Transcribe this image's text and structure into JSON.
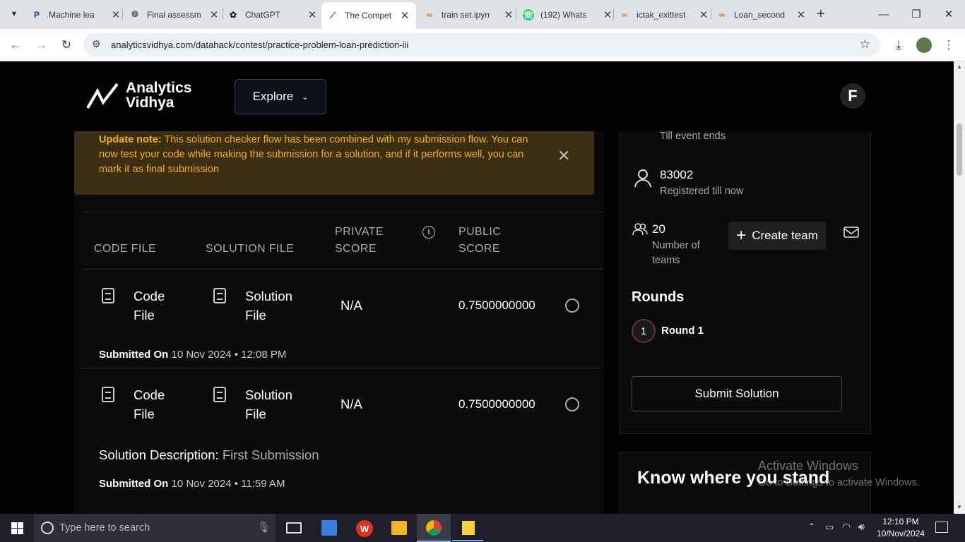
{
  "browser": {
    "tabs": [
      {
        "title": "Machine lea",
        "icon": "p-icon",
        "active": false
      },
      {
        "title": "Final assessm",
        "icon": "globe-icon",
        "active": false
      },
      {
        "title": "ChatGPT",
        "icon": "chatgpt-icon",
        "active": false
      },
      {
        "title": "The Compet",
        "icon": "av-icon",
        "active": true
      },
      {
        "title": "train set.ipyn",
        "icon": "colab-icon",
        "active": false
      },
      {
        "title": "(192) Whats",
        "icon": "whatsapp-icon",
        "active": false
      },
      {
        "title": "ictak_exittest",
        "icon": "colab-icon",
        "active": false
      },
      {
        "title": "Loan_second",
        "icon": "colab-icon",
        "active": false
      }
    ],
    "url": "analyticsvidhya.com/datahack/contest/practice-problem-loan-prediction-iii"
  },
  "header": {
    "logo_line1": "Analytics",
    "logo_line2": "Vidhya",
    "explore_label": "Explore",
    "avatar_letter": "F"
  },
  "note": {
    "label": "Update note:",
    "text": " This solution checker flow has been combined with my submission flow. You can now test your code while making the submission for a solution, and if it performs well, you can mark it as final submission"
  },
  "table": {
    "headers": {
      "code_file": "CODE FILE",
      "solution_file": "SOLUTION FILE",
      "private_score_1": "PRIVATE",
      "private_score_2": "SCORE",
      "public_score_1": "PUBLIC",
      "public_score_2": "SCORE"
    },
    "rows": [
      {
        "code_1": "Code",
        "code_2": "File",
        "sol_1": "Solution",
        "sol_2": "File",
        "private": "N/A",
        "public": "0.7500000000",
        "submitted_label": "Submitted On",
        "date": "10 Nov 2024",
        "time": "12:08 PM"
      },
      {
        "code_1": "Code",
        "code_2": "File",
        "sol_1": "Solution",
        "sol_2": "File",
        "private": "N/A",
        "public": "0.7500000000",
        "desc_label": "Solution Description:",
        "desc": "First Submission",
        "submitted_label": "Submitted On",
        "date": "10 Nov 2024",
        "time": "11:59 AM"
      }
    ]
  },
  "side": {
    "till_event": "Till event ends",
    "registered_count": "83002",
    "registered_label": "Registered till now",
    "teams_count": "20",
    "teams_label_1": "Number of",
    "teams_label_2": "teams",
    "create_team": "Create team",
    "rounds_title": "Rounds",
    "round_num": "1",
    "round_label": "Round 1",
    "submit_label": "Submit Solution",
    "know_title": "Know where you stand"
  },
  "watermark": {
    "line1": "Activate Windows",
    "line2": "Go to Settings to activate Windows."
  },
  "taskbar": {
    "search_placeholder": "Type here to search",
    "time": "12:10 PM",
    "date": "10/Nov/2024"
  }
}
